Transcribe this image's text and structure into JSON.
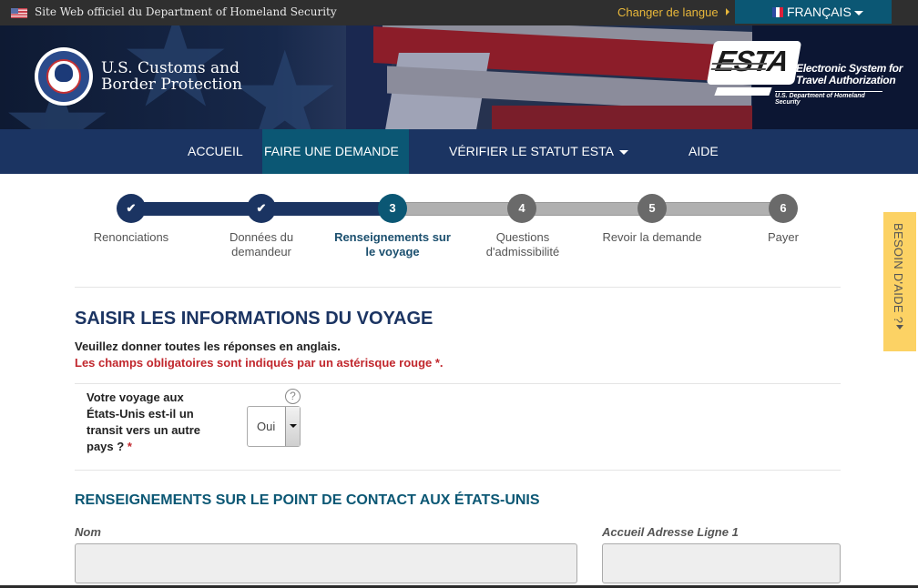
{
  "topbar": {
    "official_site": "Site Web officiel du Department of Homeland Security",
    "change_language": "Changer de langue",
    "language": "FRANÇAIS"
  },
  "banner": {
    "agency_line1": "U.S. Customs and",
    "agency_line2": "Border Protection",
    "esta_logo": "ESTA",
    "esta_desc_line1": "Electronic System for",
    "esta_desc_line2": "Travel Authorization",
    "esta_dept": "U.S. Department of Homeland Security"
  },
  "nav": {
    "items": [
      {
        "label": "ACCUEIL",
        "active": false,
        "dropdown": false
      },
      {
        "label": "FAIRE UNE DEMANDE",
        "active": true,
        "dropdown": true
      },
      {
        "label": "VÉRIFIER LE STATUT ESTA",
        "active": false,
        "dropdown": true
      },
      {
        "label": "AIDE",
        "active": false,
        "dropdown": false
      }
    ]
  },
  "progress": {
    "current_step": 3,
    "total_steps": 6,
    "steps": [
      {
        "marker": "✔",
        "label": "Renonciations",
        "state": "done"
      },
      {
        "marker": "✔",
        "label": "Données du demandeur",
        "state": "done"
      },
      {
        "marker": "3",
        "label": "Renseignements sur le voyage",
        "state": "current"
      },
      {
        "marker": "4",
        "label": "Questions d'admissibilité",
        "state": "todo"
      },
      {
        "marker": "5",
        "label": "Revoir la demande",
        "state": "todo"
      },
      {
        "marker": "6",
        "label": "Payer",
        "state": "todo"
      }
    ]
  },
  "form": {
    "title": "SAISIR LES INFORMATIONS DU VOYAGE",
    "instruction": "Veuillez donner toutes les réponses en anglais.",
    "required_note": "Les champs obligatoires sont indiqués par un astérisque rouge *.",
    "transit_question": {
      "label": "Votre voyage aux États-Unis est-il un transit vers un autre pays ?",
      "required_mark": "*",
      "help": "?",
      "value": "Oui"
    },
    "contact_section": {
      "title": "RENSEIGNEMENTS SUR LE POINT DE CONTACT AUX ÉTATS-UNIS",
      "name_label": "Nom",
      "name_value": "",
      "address_label": "Accueil Adresse Ligne 1",
      "address_value": ""
    }
  },
  "help_tab": {
    "label": "BESOIN D'AIDE ?"
  }
}
